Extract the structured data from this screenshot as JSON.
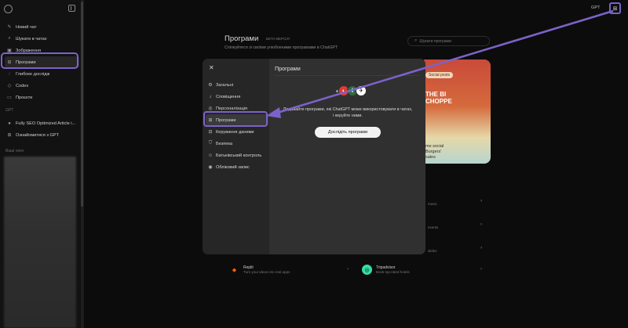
{
  "sidebar": {
    "items": [
      {
        "label": "Новий чат",
        "icon": "edit-icon"
      },
      {
        "label": "Шукати в чатах",
        "icon": "search-icon"
      },
      {
        "label": "Зображення",
        "icon": "image-icon"
      },
      {
        "label": "Програми",
        "icon": "apps-grid-icon",
        "active": true
      },
      {
        "label": "Глибоке дослідж",
        "icon": "research-icon"
      },
      {
        "label": "Codex",
        "icon": "codex-icon"
      },
      {
        "label": "Проєкти",
        "icon": "folder-icon"
      }
    ],
    "gpt_section": "GPT",
    "gpts": [
      {
        "label": "Fully SEO Optimized Article i..."
      },
      {
        "label": "Ознайомитися з GPT"
      }
    ],
    "chats_section": "Ваші чати"
  },
  "topbar": {
    "gpt_label": "GPT"
  },
  "background": {
    "title": "Програми",
    "beta": "БЕТА-ВЕРСІЯ",
    "subtitle": "Спілкуйтеся зі своїми улюбленими програмами в ChatGPT",
    "search_placeholder": "Шукати програми",
    "card": {
      "pill": "Social posts",
      "burger": "THE BI\nCHOPPE",
      "caption": "me social\nBurgers'\nsales"
    },
    "right_rows": [
      "music",
      "events",
      "slides"
    ],
    "apps": [
      {
        "name": "Replit",
        "desc": "Turn your ideas into real apps",
        "color": "#f26207"
      },
      {
        "name": "Tripadvisor",
        "desc": "Book top-rated hotels",
        "color": "#34e0a1"
      }
    ]
  },
  "modal": {
    "title": "Програми",
    "close_label": "✕",
    "menu": [
      {
        "label": "Загальні",
        "icon": "gear-icon"
      },
      {
        "label": "Сповіщення",
        "icon": "bell-icon"
      },
      {
        "label": "Персоналізація",
        "icon": "personalization-icon"
      },
      {
        "label": "Програми",
        "icon": "apps-grid-icon",
        "active": true
      },
      {
        "label": "Керування даними",
        "icon": "data-icon"
      },
      {
        "label": "Безпека",
        "icon": "shield-icon"
      },
      {
        "label": "Батьківський контроль",
        "icon": "family-icon"
      },
      {
        "label": "Обліковий запис",
        "icon": "account-icon"
      }
    ],
    "description": "Додавайте програми, які ChatGPT може використовувати в чатах, і керуйте ними.",
    "explore_button": "Дослідіть програми",
    "app_icon_colors": [
      "#e23b2f",
      "#2f6b3a",
      "#ffffff"
    ]
  },
  "annotation_color": "#7b62c9"
}
